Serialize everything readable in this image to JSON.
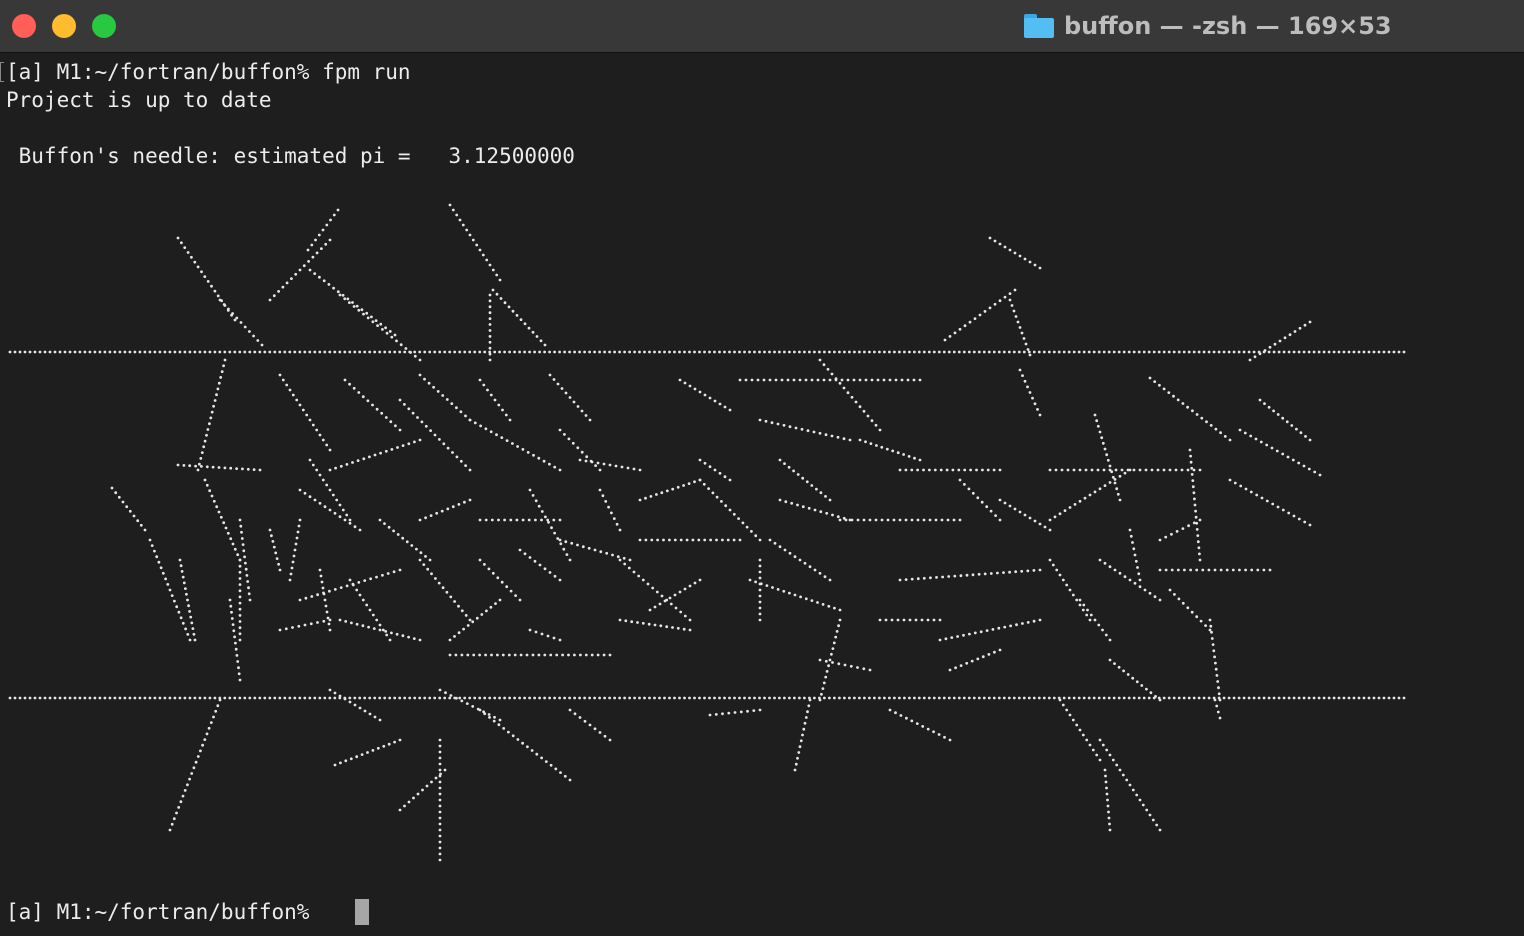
{
  "window": {
    "title": "buffon — -zsh — 169×53",
    "folder_icon": "folder-icon",
    "colors": {
      "close": "#ff5f57",
      "minimize": "#febc2e",
      "zoom": "#28c840"
    }
  },
  "terminal": {
    "command_line": "[a] M1:~/fortran/buffon% fpm run",
    "status_line": "Project is up to date",
    "result_line": " Buffon's needle: estimated pi =   3.12500000",
    "final_prompt": "[a] M1:~/fortran/buffon%",
    "colors": {
      "background": "#1e1e1e",
      "text": "#ececec",
      "cursor": "#a6a6a6"
    }
  }
}
